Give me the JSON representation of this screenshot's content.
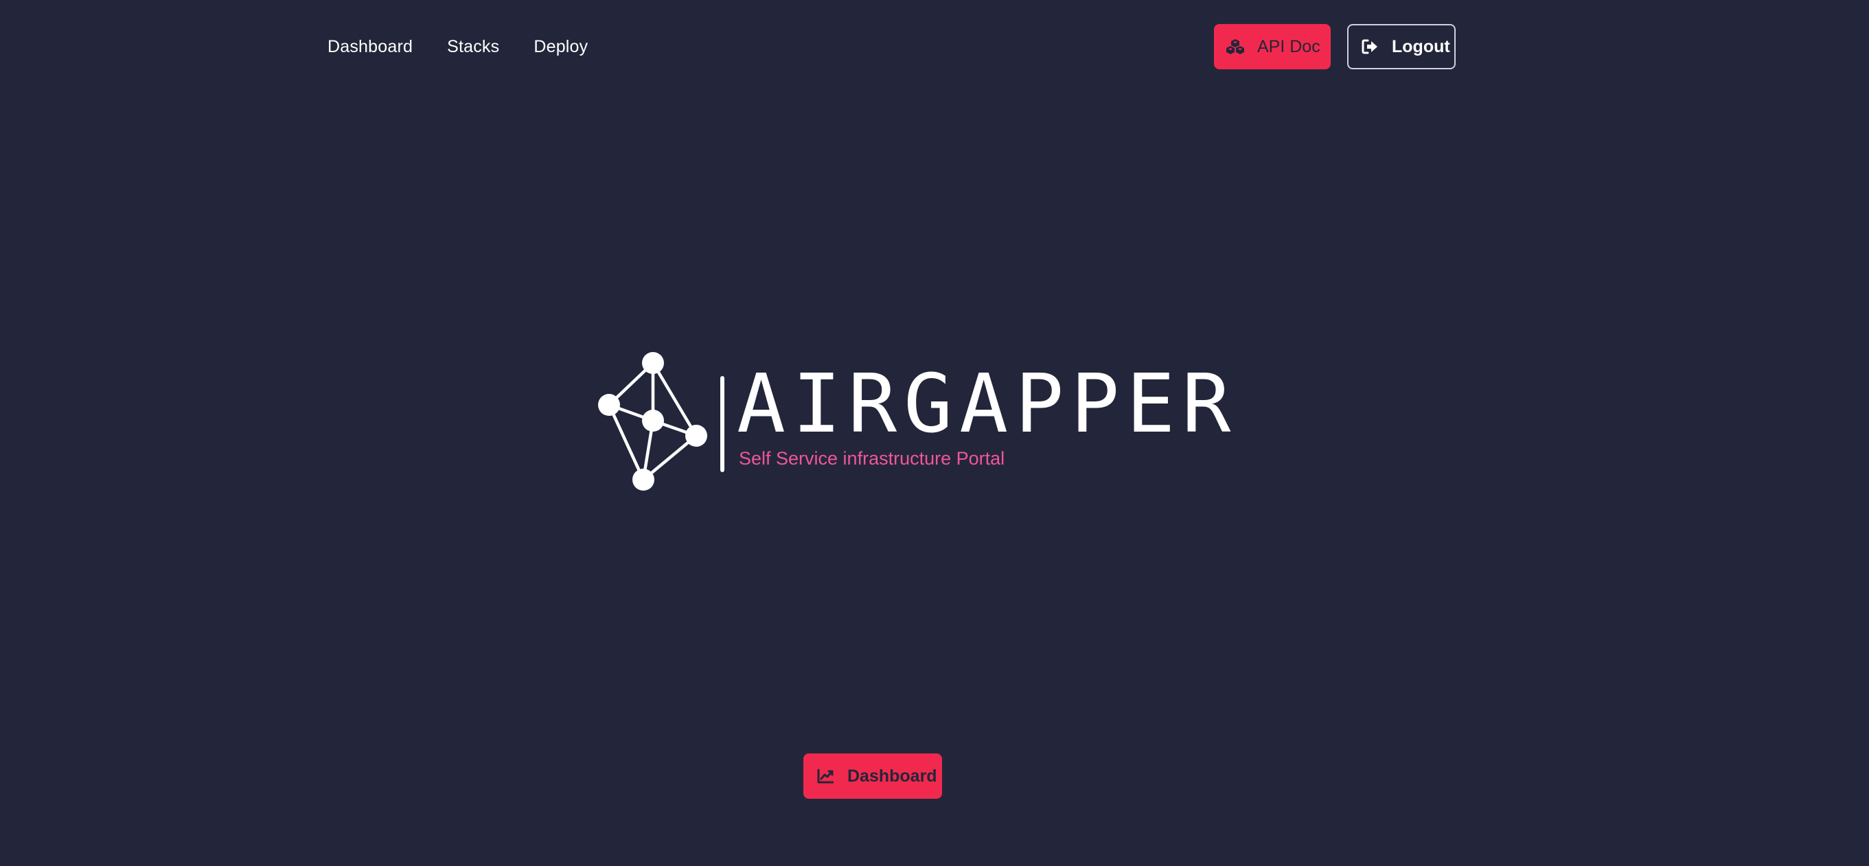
{
  "nav": {
    "links": [
      "Dashboard",
      "Stacks",
      "Deploy"
    ]
  },
  "header_buttons": {
    "api_doc": {
      "label": "API Doc",
      "icon": "cubes-icon"
    },
    "logout": {
      "label": "Logout",
      "icon": "sign-out-icon"
    }
  },
  "logo": {
    "title": "AIRGAPPER",
    "subtitle": "Self Service infrastructure Portal",
    "icon": "network-graph-logo-icon"
  },
  "main_button": {
    "label": "Dashboard",
    "icon": "chart-line-icon"
  },
  "colors": {
    "background": "#23263a",
    "accent": "#f2294e",
    "subtitle": "#f0569a",
    "text": "#ffffff"
  }
}
